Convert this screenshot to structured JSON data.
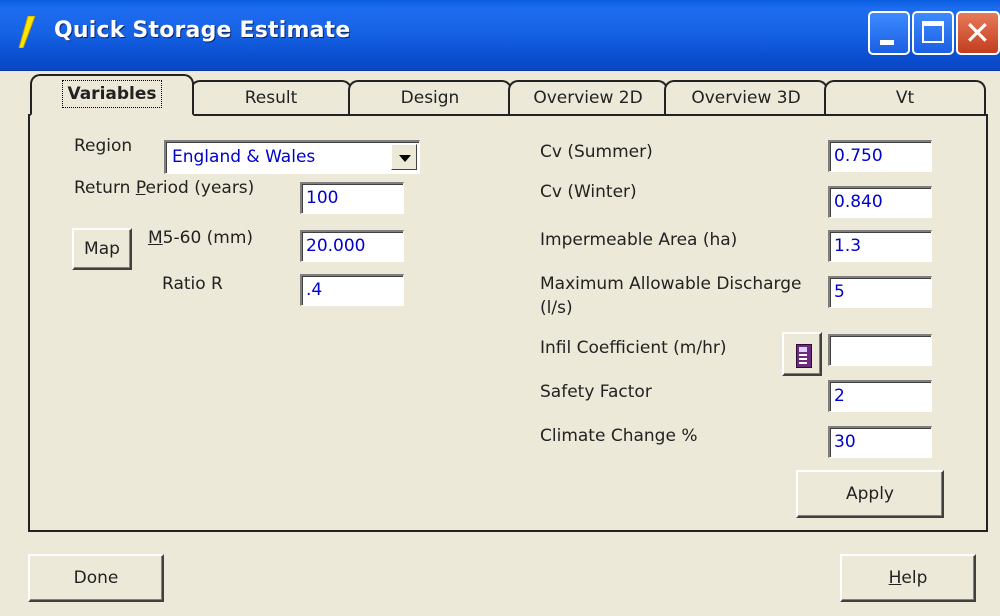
{
  "window": {
    "title": "Quick Storage Estimate",
    "icon": "lightning-icon"
  },
  "tabs": [
    {
      "label": "Variables",
      "active": true
    },
    {
      "label": "Result"
    },
    {
      "label": "Design"
    },
    {
      "label": "Overview 2D"
    },
    {
      "label": "Overview 3D"
    },
    {
      "label": "Vt"
    }
  ],
  "left": {
    "region_label": "Region",
    "region_value": "England & Wales",
    "return_period_label_pre": "Return ",
    "return_period_label_u": "P",
    "return_period_label_post": "eriod (years)",
    "return_period_value": "100",
    "map_button": "Map",
    "m560_label_u": "M",
    "m560_label_post": "5-60 (mm)",
    "m560_value": "20.000",
    "ratio_label": "Ratio R",
    "ratio_value": ".4"
  },
  "right": {
    "cv_summer_label": "Cv (Summer)",
    "cv_summer_value": "0.750",
    "cv_winter_label": "Cv (Winter)",
    "cv_winter_value": "0.840",
    "imp_area_label": "Impermeable Area (ha)",
    "imp_area_value": "1.3",
    "max_discharge_label_1": "Maximum Allowable Discharge",
    "max_discharge_label_2": "(l/s)",
    "max_discharge_value": "5",
    "infil_label": "Infil Coefficient (m/hr)",
    "infil_value": "",
    "safety_label": "Safety Factor",
    "safety_value": "2",
    "climate_label": "Climate Change %",
    "climate_value": "30",
    "apply_button": "Apply"
  },
  "footer": {
    "done_button": "Done",
    "help_button_u": "H",
    "help_button_post": "elp"
  },
  "colors": {
    "title_bar": "#0b4fd1",
    "field_text": "#0000cc",
    "face": "#ece9d8"
  }
}
